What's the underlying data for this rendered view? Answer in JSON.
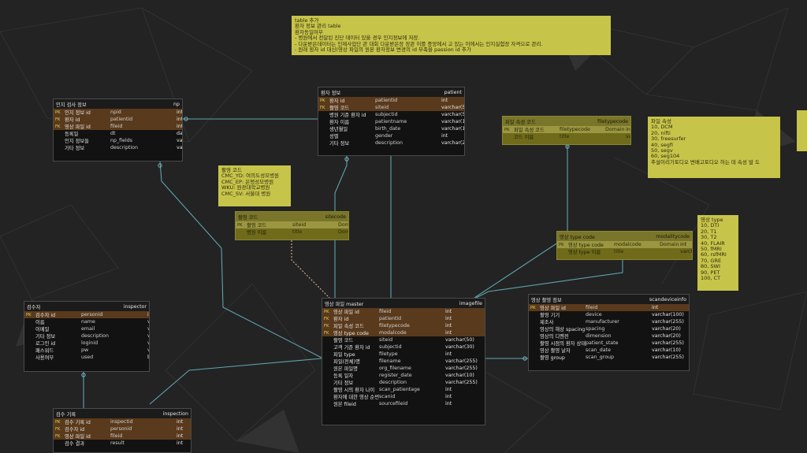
{
  "notes": {
    "top": [
      "table 추가",
      "환자 정보 관리 table",
      "환자동일여부",
      "- 병원에서 전달된 진단 데이터 있을 경우 인지정보에 저장.",
      "- 다운받은데이터는 인제사업단 관 대회 다운받은장 장관 이를 중앙에서 고 있는 이에서는 인지실험장 자격으로 관리.",
      "- 원래 환자 id 대신(영상 파일의 원본 환자정보 변경의 id 부족을 passion id 추가"
    ],
    "site": [
      "촬영 코드",
      "CMC_YD: 여의도성모병원",
      "CMC_EP: 은평성모병원",
      "WKU: 원광대학교병원",
      "CMC_SV: 서울대 병원"
    ],
    "filetype": [
      "파일 속성",
      "10, DCM",
      "20, nifti",
      "30, freesurfer",
      "40, segfi",
      "50, segv",
      "60, seg104",
      "",
      "추설이리기토디오 변배고토디오 하는 데 속성 발 도"
    ],
    "modality": [
      "영상 type",
      "10, DTI",
      "20, T1",
      "30, T2",
      "40, FLAIR",
      "50, fMRI",
      "60, rsfMRI",
      "70, GRE",
      "80, SWI",
      "90, PET",
      "100, CT"
    ]
  },
  "entities": {
    "np": {
      "title": "인지 검사 정보",
      "table": "np",
      "rows": [
        {
          "key": "PK",
          "name": "인지 정보 id",
          "phys": "npid",
          "dom": "",
          "type": "int",
          "pk": true
        },
        {
          "key": "FK",
          "name": "환자 id",
          "phys": "patientid",
          "dom": "",
          "type": "int",
          "pk": true
        },
        {
          "key": "FK",
          "name": "영상 파일 id",
          "phys": "fileid",
          "dom": "",
          "type": "int",
          "pk": true
        },
        {
          "key": "",
          "name": "등록일",
          "phys": "dt",
          "dom": "",
          "type": "date",
          "pk": false
        },
        {
          "key": "",
          "name": "인지 정보들",
          "phys": "np_fields",
          "dom": "",
          "type": "varchar(255)",
          "pk": false
        },
        {
          "key": "",
          "name": "기타 정보",
          "phys": "description",
          "dom": "",
          "type": "varchar(255)",
          "pk": false
        }
      ]
    },
    "patient": {
      "title": "환자 정보",
      "table": "patient",
      "rows": [
        {
          "key": "PK",
          "name": "환자 id",
          "phys": "patientid",
          "dom": "",
          "type": "int",
          "pk": true
        },
        {
          "key": "FK",
          "name": "촬영 코드",
          "phys": "siteid",
          "dom": "",
          "type": "varchar(50)",
          "pk": true
        },
        {
          "key": "",
          "name": "병원 기준 환자 id",
          "phys": "subjectid",
          "dom": "",
          "type": "varchar(50)",
          "pk": false
        },
        {
          "key": "",
          "name": "환자 이름",
          "phys": "patientname",
          "dom": "",
          "type": "varchar(100)",
          "pk": false
        },
        {
          "key": "",
          "name": "생년월일",
          "phys": "birth_date",
          "dom": "",
          "type": "varchar(10)",
          "pk": false
        },
        {
          "key": "",
          "name": "성별",
          "phys": "gender",
          "dom": "",
          "type": "int",
          "pk": false
        },
        {
          "key": "",
          "name": "기타 정보",
          "phys": "description",
          "dom": "",
          "type": "varchar(255)",
          "pk": false
        }
      ]
    },
    "filetype": {
      "title": "파일 속성 코드",
      "table": "filetypecode",
      "rows": [
        {
          "key": "PK",
          "name": "파일 속성 코드",
          "phys": "filetypecode",
          "dom": "Domain",
          "type": "int",
          "pk": true
        },
        {
          "key": "",
          "name": "코드 이름",
          "phys": "title",
          "dom": "",
          "type": "varchar(20)",
          "pk": false
        }
      ]
    },
    "site": {
      "title": "촬영 코드",
      "table": "sitecode",
      "rows": [
        {
          "key": "PK",
          "name": "촬영 코드",
          "phys": "siteid",
          "dom": "Domain",
          "type": "varchar(50)",
          "pk": true
        },
        {
          "key": "",
          "name": "병원 이름",
          "phys": "title",
          "dom": "Domain",
          "type": "varchar(50)",
          "pk": false
        }
      ]
    },
    "modality": {
      "title": "영상 type code",
      "table": "modalitycode",
      "rows": [
        {
          "key": "PK",
          "name": "영상 type code",
          "phys": "modalcode",
          "dom": "Domain",
          "type": "int",
          "pk": true
        },
        {
          "key": "",
          "name": "영상 type 이름",
          "phys": "title",
          "dom": "",
          "type": "varchar(20)",
          "pk": false
        }
      ]
    },
    "inspector": {
      "title": "검수자",
      "table": "inspector",
      "rows": [
        {
          "key": "PK",
          "name": "검수자 id",
          "phys": "personid",
          "dom": "",
          "type": "int",
          "pk": true
        },
        {
          "key": "",
          "name": "이름",
          "phys": "name",
          "dom": "",
          "type": "varchar(30)",
          "pk": false
        },
        {
          "key": "",
          "name": "이메일",
          "phys": "email",
          "dom": "",
          "type": "varchar(30)",
          "pk": false
        },
        {
          "key": "",
          "name": "기타 정보",
          "phys": "description",
          "dom": "",
          "type": "varchar(255)",
          "pk": false
        },
        {
          "key": "",
          "name": "로그인 id",
          "phys": "loginid",
          "dom": "",
          "type": "varchar(30)",
          "pk": false
        },
        {
          "key": "",
          "name": "패스워드",
          "phys": "pw",
          "dom": "",
          "type": "varchar(30)",
          "pk": false
        },
        {
          "key": "",
          "name": "사용여부",
          "phys": "used",
          "dom": "",
          "type": "bool",
          "pk": false
        }
      ]
    },
    "image": {
      "title": "영상 파일 master",
      "table": "imagefile",
      "rows": [
        {
          "key": "PK",
          "name": "영상 파일 id",
          "phys": "fileid",
          "dom": "",
          "type": "int",
          "pk": true
        },
        {
          "key": "FK",
          "name": "환자 id",
          "phys": "patientid",
          "dom": "",
          "type": "int",
          "pk": true
        },
        {
          "key": "FK",
          "name": "파일 속성 코드",
          "phys": "filetypecode",
          "dom": "",
          "type": "int",
          "pk": true
        },
        {
          "key": "FK",
          "name": "영상 type code",
          "phys": "modalcode",
          "dom": "",
          "type": "int",
          "pk": true
        },
        {
          "key": "",
          "name": "촬영 코드",
          "phys": "siteid",
          "dom": "",
          "type": "varchar(50)",
          "pk": false
        },
        {
          "key": "",
          "name": "고객 기준 환자 id",
          "phys": "subjectid",
          "dom": "",
          "type": "varchar(30)",
          "pk": false
        },
        {
          "key": "",
          "name": "파일 type",
          "phys": "filetype",
          "dom": "",
          "type": "int",
          "pk": false
        },
        {
          "key": "",
          "name": "파일(전체)명",
          "phys": "filename",
          "dom": "",
          "type": "varchar(255)",
          "pk": false
        },
        {
          "key": "",
          "name": "원본 파일명",
          "phys": "org_filename",
          "dom": "",
          "type": "varchar(255)",
          "pk": false
        },
        {
          "key": "",
          "name": "등록 일자",
          "phys": "register_date",
          "dom": "",
          "type": "varchar(10)",
          "pk": false
        },
        {
          "key": "",
          "name": "기타 정보",
          "phys": "description",
          "dom": "",
          "type": "varchar(255)",
          "pk": false
        },
        {
          "key": "",
          "name": "촬영 시의 환자 나이",
          "phys": "scan_patientage",
          "dom": "",
          "type": "int",
          "pk": false
        },
        {
          "key": "",
          "name": "환자에 대한 영상 순번",
          "phys": "scanid",
          "dom": "",
          "type": "int",
          "pk": false
        },
        {
          "key": "",
          "name": "원본 fileid",
          "phys": "sourcefileid",
          "dom": "",
          "type": "int",
          "pk": false
        }
      ]
    },
    "scan": {
      "title": "영상 촬영 정보",
      "table": "scandeviceinfo",
      "rows": [
        {
          "key": "PK",
          "name": "영상 파일 id",
          "phys": "fileid",
          "dom": "",
          "type": "int",
          "pk": true
        },
        {
          "key": "",
          "name": "촬영 기기",
          "phys": "device",
          "dom": "",
          "type": "varchar(100)",
          "pk": false
        },
        {
          "key": "",
          "name": "제조사",
          "phys": "manufacturer",
          "dom": "",
          "type": "varchar(255)",
          "pk": false
        },
        {
          "key": "",
          "name": "영상의 해상 spacing",
          "phys": "spacing",
          "dom": "",
          "type": "varchar(20)",
          "pk": false
        },
        {
          "key": "",
          "name": "영상의 디멘전",
          "phys": "dimension",
          "dom": "",
          "type": "varchar(20)",
          "pk": false
        },
        {
          "key": "",
          "name": "촬영 시점의 환자 상태",
          "phys": "patient_state",
          "dom": "",
          "type": "varchar(255)",
          "pk": false
        },
        {
          "key": "",
          "name": "영상 촬영 날자",
          "phys": "scan_date",
          "dom": "",
          "type": "varchar(10)",
          "pk": false
        },
        {
          "key": "",
          "name": "촬영 group",
          "phys": "scan_group",
          "dom": "",
          "type": "varchar(255)",
          "pk": false
        }
      ]
    },
    "inspection": {
      "title": "검수 기록",
      "table": "inspection",
      "rows": [
        {
          "key": "PK",
          "name": "검수 기록 id",
          "phys": "inspectid",
          "dom": "",
          "type": "int",
          "pk": true
        },
        {
          "key": "FK",
          "name": "검수자 id",
          "phys": "personid",
          "dom": "",
          "type": "int",
          "pk": true
        },
        {
          "key": "FK",
          "name": "영상 파일 id",
          "phys": "fileid",
          "dom": "",
          "type": "int",
          "pk": true
        },
        {
          "key": "",
          "name": "검수 결과",
          "phys": "result",
          "dom": "",
          "type": "int",
          "pk": false
        }
      ]
    }
  }
}
